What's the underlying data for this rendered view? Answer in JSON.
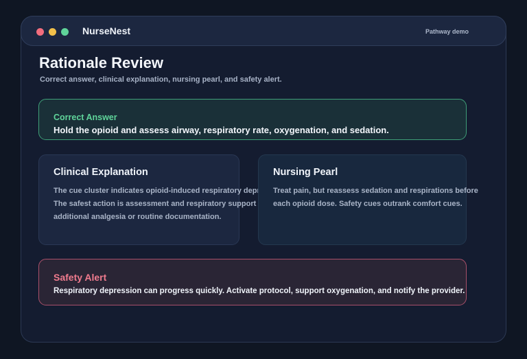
{
  "app": {
    "name": "NurseNest",
    "mode": "Pathway demo"
  },
  "colors": {
    "background": "#0f1623",
    "window": "#141c30",
    "success": "#5fd49a",
    "danger": "#f07b8e",
    "window_control_red": "#f26d7d",
    "window_control_yellow": "#f2c04a",
    "window_control_green": "#5fd49a"
  },
  "page": {
    "title": "Rationale Review",
    "subtitle": "Correct answer, clinical explanation, nursing pearl, and safety alert."
  },
  "correct_answer": {
    "label": "Correct Answer",
    "text": "Hold the opioid and assess airway, respiratory rate, oxygenation, and sedation."
  },
  "clinical_explanation": {
    "heading": "Clinical Explanation",
    "body": "The cue cluster indicates opioid-induced respiratory depression.\nThe safest action is assessment and respiratory support before\nadditional analgesia or routine documentation."
  },
  "nursing_pearl": {
    "heading": "Nursing Pearl",
    "body": "Treat pain, but reassess sedation and respirations before\neach opioid dose. Safety cues outrank comfort cues."
  },
  "safety_alert": {
    "label": "Safety Alert",
    "text": "Respiratory depression can progress quickly. Activate protocol, support oxygenation, and notify the provider."
  }
}
